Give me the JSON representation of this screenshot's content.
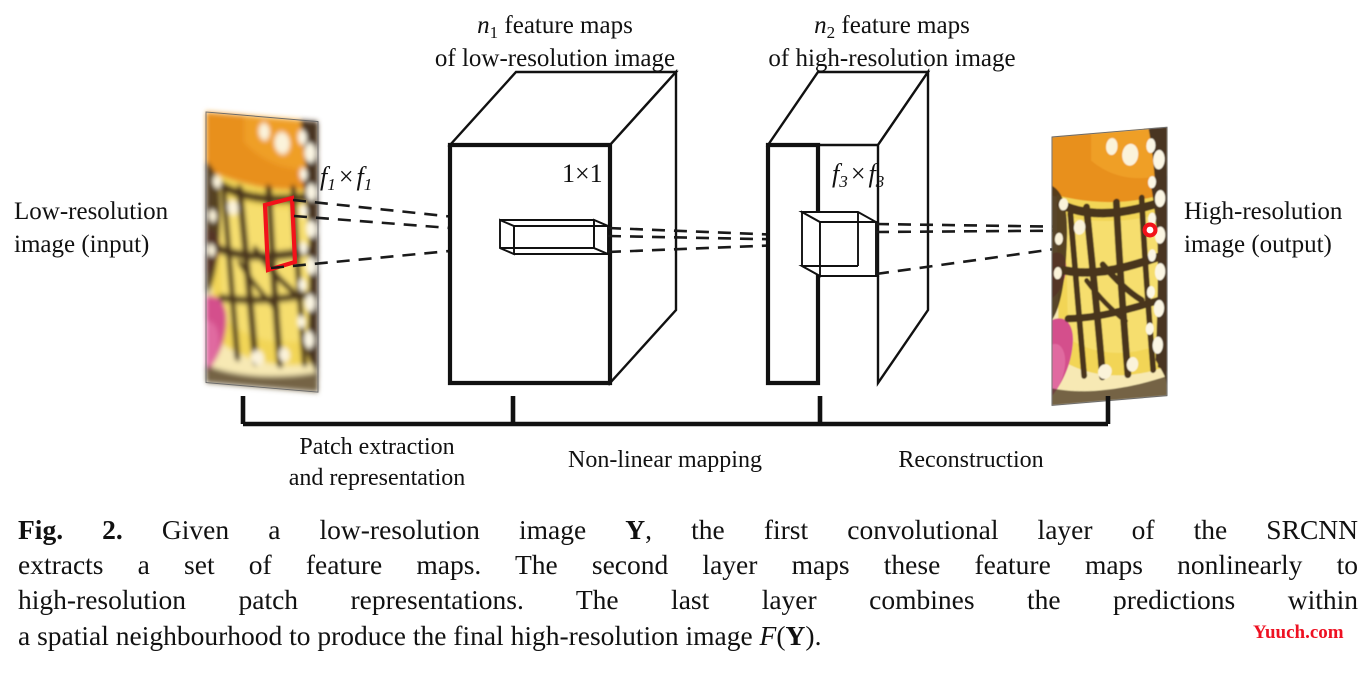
{
  "figure": {
    "number": "Fig. 2.",
    "top_labels": [
      {
        "name": "n1-feature-maps-label",
        "line1_prefix": "n",
        "line1_sub": "1",
        "line1_suffix": " feature maps",
        "line2": "of low-resolution image"
      },
      {
        "name": "n2-feature-maps-label",
        "line1_prefix": "n",
        "line1_sub": "2",
        "line1_suffix": " feature maps",
        "line2": "of high-resolution image"
      }
    ],
    "left_label": {
      "line1": "Low-resolution",
      "line2": "image (input)"
    },
    "right_label": {
      "line1": "High-resolution",
      "line2": "image (output)"
    },
    "kernel_labels": {
      "first": {
        "base": "f",
        "sub": "1",
        "op": "×"
      },
      "middle": {
        "text": "1×1"
      },
      "third": {
        "base": "f",
        "sub": "3",
        "op": "×"
      }
    },
    "stages": [
      {
        "name": "stage-patch-extraction",
        "line1": "Patch extraction",
        "line2": "and representation"
      },
      {
        "name": "stage-nonlinear-mapping",
        "line1": "Non-linear mapping",
        "line2": ""
      },
      {
        "name": "stage-reconstruction",
        "line1": "Reconstruction",
        "line2": ""
      }
    ],
    "caption": {
      "label": "Fig. 2.",
      "line1_a": " Given a low-resolution image ",
      "line1_y": "Y",
      "line1_b": ", the first convolutional layer of the SRCNN",
      "line2": "extracts a set of feature maps. The second layer maps these feature maps nonlinearly to",
      "line3": "high-resolution patch representations. The last layer combines the predictions within",
      "line4_a": "a spatial neighbourhood to produce the final high-resolution image ",
      "line4_f": "F",
      "line4_paren_open": "(",
      "line4_y": "Y",
      "line4_paren_close": ").",
      "full_text": "Fig. 2. Given a low-resolution image Y, the first convolutional layer of the SRCNN extracts a set of feature maps. The second layer maps these feature maps nonlinearly to high-resolution patch representations. The last layer combines the predictions within a spatial neighbourhood to produce the final high-resolution image F(Y)."
    },
    "watermark": {
      "text": "Yuuch.com",
      "color": "#ee1122"
    },
    "colors": {
      "stroke": "#111111",
      "patch_highlight": "#f2121a",
      "output_marker_ring": "#f2121a",
      "output_marker_center": "#ffffff",
      "butterfly_yellow": "#f5d84e",
      "butterfly_orange": "#e8901f",
      "butterfly_dark": "#4a3520",
      "butterfly_flower": "#d4508c",
      "background": "#ffffff"
    },
    "icon_names": [
      "butterfly-lowres-thumbnail",
      "butterfly-highres-thumbnail",
      "feature-map-block-1",
      "feature-map-block-2",
      "kernel-cuboid-1x1",
      "kernel-cube-f3",
      "patch-highlight-quad",
      "output-pixel-marker",
      "stage-bracket"
    ]
  }
}
